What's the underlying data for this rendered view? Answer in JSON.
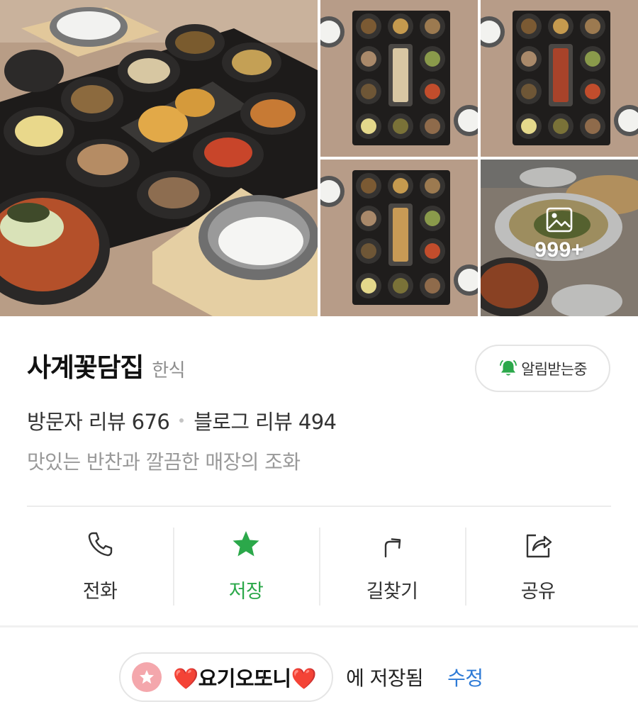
{
  "gallery": {
    "photo_count": 5,
    "more_count": "999+"
  },
  "place": {
    "name": "사계꽃담집",
    "category": "한식",
    "notify_label": "알림받는중",
    "visitor_review_label": "방문자 리뷰 676",
    "blog_review_label": "블로그 리뷰 494",
    "description": "맛있는 반찬과 깔끔한 매장의 조화"
  },
  "actions": [
    {
      "label": "전화",
      "icon": "phone-icon"
    },
    {
      "label": "저장",
      "icon": "star-icon",
      "active": true
    },
    {
      "label": "길찾기",
      "icon": "directions-icon"
    },
    {
      "label": "공유",
      "icon": "share-icon"
    }
  ],
  "saved": {
    "list_name": "❤️요기오또니❤️",
    "suffix": "에 저장됨",
    "edit_label": "수정"
  },
  "colors": {
    "accent_green": "#2ba84a",
    "link_blue": "#2d7ad6",
    "chip_pink": "#f4a7ac"
  }
}
